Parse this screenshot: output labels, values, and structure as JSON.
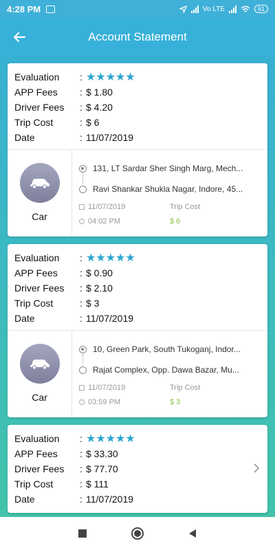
{
  "status_bar": {
    "time": "4:28 PM",
    "network": "Vo LTE",
    "battery": "61",
    "icons": [
      "notification-icon",
      "location-arrow-icon",
      "signal-icon",
      "wifi-icon",
      "battery-icon"
    ]
  },
  "app_bar": {
    "title": "Account Statement",
    "back_icon": "arrow-left-icon"
  },
  "labels": {
    "evaluation": "Evaluation",
    "app_fees": "APP Fees",
    "driver_fees": "Driver Fees",
    "trip_cost": "Trip Cost",
    "date": "Date",
    "colon": ":",
    "meta_trip_cost": "Trip Cost"
  },
  "theme": {
    "accent": "#2aa5cf",
    "price_green": "#8bc34a",
    "bar": "#37b1d9"
  },
  "statements": [
    {
      "stars": "★★★★★",
      "rating": 5,
      "app_fees": "$ 1.80",
      "driver_fees": "$ 4.20",
      "trip_cost": "$ 6",
      "date": "11/07/2019",
      "vehicle": "Car",
      "pickup": "131, LT Sardar Sher Singh Marg, Mech...",
      "dropoff": "Ravi Shankar Shukla Nagar, Indore, 45...",
      "trip_date": "11/07/2019",
      "trip_time": "04:02 PM",
      "price": "$ 6"
    },
    {
      "stars": "★★★★★",
      "rating": 5,
      "app_fees": "$ 0.90",
      "driver_fees": "$ 2.10",
      "trip_cost": "$ 3",
      "date": "11/07/2019",
      "vehicle": "Car",
      "pickup": "10, Green Park, South Tukoganj, Indor...",
      "dropoff": "Rajat Complex, Opp. Dawa Bazar, Mu...",
      "trip_date": "11/07/2019",
      "trip_time": "03:59 PM",
      "price": "$ 3"
    },
    {
      "stars": "★★★★★",
      "rating": 5,
      "app_fees": "$ 33.30",
      "driver_fees": "$ 77.70",
      "trip_cost": "$ 111",
      "date": "11/07/2019"
    }
  ]
}
